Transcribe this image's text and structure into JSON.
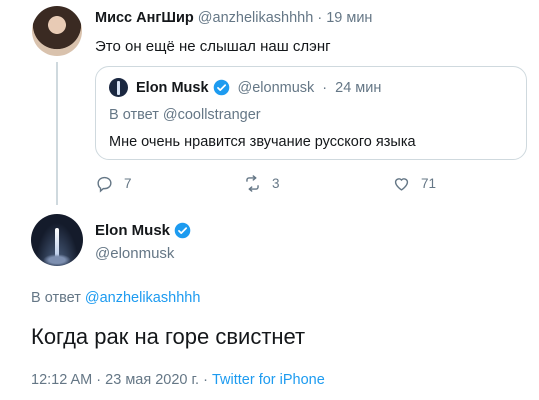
{
  "reply_tweet": {
    "author_name": "Мисс АнгШир",
    "author_handle": "@anzhelikashhhh",
    "separator": "·",
    "time_ago": "19 мин",
    "text": "Это он ещё не слышал наш слэнг",
    "quoted": {
      "author_name": "Elon Musk",
      "author_handle": "@elonmusk",
      "separator": "·",
      "time_ago": "24 мин",
      "reply_prefix": "В ответ",
      "reply_to": "@coollstranger",
      "text": "Мне очень нравится звучание русского языка"
    },
    "actions": {
      "replies": "7",
      "retweets": "3",
      "likes": "71"
    }
  },
  "main_tweet": {
    "author_name": "Elon Musk",
    "author_handle": "@elonmusk",
    "reply_prefix": "В ответ",
    "reply_to": "@anzhelikashhhh",
    "text": "Когда рак на горе свистнет",
    "time": "12:12 AM",
    "separator1": "·",
    "date": "23 мая 2020 г.",
    "separator2": "·",
    "source": "Twitter for iPhone"
  },
  "colors": {
    "accent": "#1d9bf0",
    "muted": "#657786",
    "text": "#14171a",
    "border": "#cfd9de"
  },
  "icons": [
    "reply-icon",
    "retweet-icon",
    "like-icon",
    "verified-badge-icon"
  ]
}
